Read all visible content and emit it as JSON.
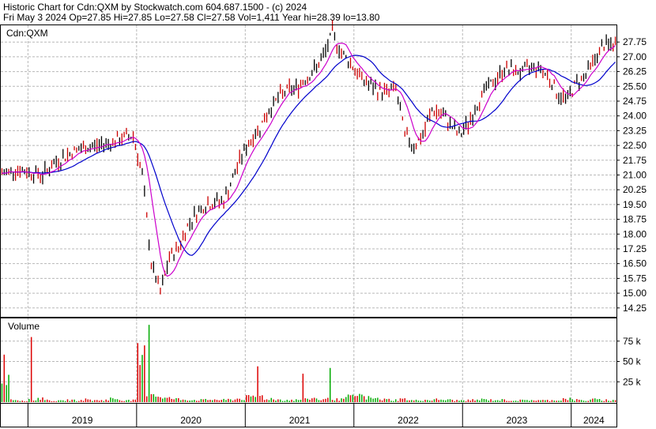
{
  "header": {
    "line1": "Historic Chart for Cdn:QXM by Stockwatch.com 604.687.1500 - (c) 2024",
    "line2": "Fri May  3 2024   Op=27.85   Hi=27.85   Lo=27.58   Cl=27.58   Vol=1,411   Year hi=28.39   lo=13.80"
  },
  "colors": {
    "price_bar_up": "#000000",
    "price_bar_down": "#cc0000",
    "ma_short": "#cc00cc",
    "ma_long": "#0000cc",
    "volume_up": "#00aa00",
    "volume_down": "#dd0000",
    "grid": "#b8b8b8",
    "border": "#000000"
  },
  "chart_data": [
    {
      "type": "line",
      "title": "Cdn:QXM",
      "ylim": [
        13.8,
        28.6
      ],
      "y_ticks": [
        "27.75",
        "27.00",
        "26.25",
        "25.50",
        "24.75",
        "24.00",
        "23.25",
        "22.50",
        "21.75",
        "21.00",
        "20.25",
        "19.50",
        "18.75",
        "18.00",
        "17.25",
        "16.50",
        "15.75",
        "15.00",
        "14.25"
      ],
      "x_ticks": [
        "2019",
        "2020",
        "2021",
        "2022",
        "2023",
        "2024"
      ],
      "grid": true,
      "series": [
        {
          "x": [
            "2018-10",
            "2018-11",
            "2018-12",
            "2019-01",
            "2019-02",
            "2019-03",
            "2019-04",
            "2019-05",
            "2019-06",
            "2019-07",
            "2019-08",
            "2019-09",
            "2019-10",
            "2019-11",
            "2019-12",
            "2020-01",
            "2020-02",
            "2020-03",
            "2020-04",
            "2020-05",
            "2020-06",
            "2020-07",
            "2020-08",
            "2020-09",
            "2020-10",
            "2020-11",
            "2020-12",
            "2021-01",
            "2021-02",
            "2021-03",
            "2021-04",
            "2021-05",
            "2021-06",
            "2021-07",
            "2021-08",
            "2021-09",
            "2021-10",
            "2021-11",
            "2021-12",
            "2022-01",
            "2022-02",
            "2022-03",
            "2022-04",
            "2022-05",
            "2022-06",
            "2022-07",
            "2022-08",
            "2022-09",
            "2022-10",
            "2022-11",
            "2022-12",
            "2023-01",
            "2023-02",
            "2023-03",
            "2023-04",
            "2023-05",
            "2023-06",
            "2023-07",
            "2023-08",
            "2023-09",
            "2023-10",
            "2023-11",
            "2023-12",
            "2024-01",
            "2024-02",
            "2024-03",
            "2024-04",
            "2024-05"
          ],
          "values": [
            21.1,
            21.3,
            21.2,
            21.1,
            21.0,
            21.5,
            21.8,
            22.1,
            22.3,
            22.4,
            22.5,
            22.6,
            22.7,
            22.9,
            23.0,
            21.0,
            16.5,
            15.0,
            16.8,
            17.3,
            18.4,
            19.1,
            19.5,
            19.6,
            19.7,
            20.8,
            22.0,
            22.8,
            23.4,
            24.3,
            24.9,
            25.3,
            25.4,
            25.9,
            26.3,
            27.0,
            28.2,
            27.2,
            26.7,
            26.0,
            25.6,
            25.3,
            25.2,
            25.4,
            23.0,
            22.5,
            23.0,
            24.3,
            24.1,
            23.6,
            23.0,
            23.6,
            24.6,
            25.4,
            25.8,
            26.4,
            26.3,
            26.2,
            26.5,
            26.4,
            25.9,
            25.0,
            24.9,
            25.7,
            26.1,
            26.9,
            27.6,
            27.58
          ]
        }
      ]
    },
    {
      "type": "bar",
      "title": "Volume",
      "y_ticks": [
        "75 k",
        "50 k",
        "25 k"
      ],
      "ylim": [
        0,
        100
      ],
      "values_k": [
        80,
        6,
        4,
        5,
        9,
        4,
        3,
        5,
        4,
        6,
        4,
        5,
        8,
        5,
        4,
        95,
        25,
        14,
        9,
        7,
        6,
        5,
        5,
        6,
        5,
        6,
        8,
        11,
        14,
        8,
        6,
        5,
        5,
        6,
        9,
        6,
        7,
        6,
        12,
        16,
        10,
        8,
        6,
        5,
        7,
        4,
        5,
        5,
        6,
        5,
        4,
        4,
        5,
        6,
        5,
        5,
        4,
        4,
        5,
        4,
        4,
        5,
        8,
        5,
        4,
        6,
        5,
        4
      ],
      "annotated_spikes_k": {
        "2019-01": 80,
        "2020-02": 95,
        "2021-02": 44,
        "2021-07": 35,
        "2021-10": 42
      }
    }
  ]
}
